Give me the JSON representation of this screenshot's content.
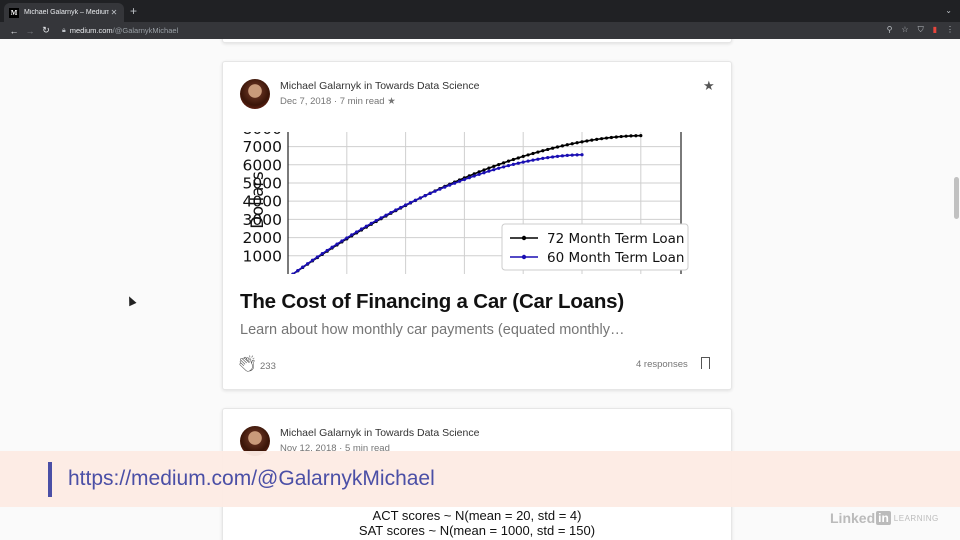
{
  "browser": {
    "tab_title": "Michael Galarnyk – Medium",
    "tab_favicon": "M",
    "url_host": "medium.com",
    "url_path": "/@GalarnykMichael",
    "icons": [
      "back-icon",
      "forward-icon",
      "reload-icon",
      "lock-icon",
      "zoom-icon",
      "bookmark-star-icon",
      "shield-icon",
      "extension-icon",
      "menu-icon"
    ]
  },
  "post": {
    "author": "Michael Galarnyk",
    "in_word": "in",
    "publication": "Towards Data Science",
    "date": "Dec 7, 2018",
    "read_time": "7 min read",
    "title": "The Cost of Financing a Car (Car Loans)",
    "subtitle": "Learn about how monthly car payments (equated monthly…",
    "claps": "233",
    "responses": "4 responses"
  },
  "post2": {
    "author": "Michael Galarnyk",
    "in_word": "in",
    "publication": "Towards Data Science",
    "date": "Nov 12, 2018",
    "read_time": "5 min read",
    "eq1": "ACT scores ~ N(mean = 20, std = 4)",
    "eq2": "SAT scores ~ N(mean = 1000, std = 150)"
  },
  "overlay_link": "https://medium.com/@GalarnykMichael",
  "watermark": {
    "brand": "Linked",
    "in": "in",
    "suffix": "LEARNING"
  },
  "colors": {
    "series72": "#000000",
    "series60": "#1a0fb3",
    "overlay_text": "#4b4fa6"
  },
  "chart_data": {
    "type": "line",
    "ylabel": "Dollars",
    "yticks": [
      1000,
      2000,
      3000,
      4000,
      5000,
      6000,
      7000
    ],
    "ylim": [
      0,
      7800
    ],
    "xlim": [
      0,
      80
    ],
    "grid": true,
    "legend_position": "lower-right",
    "series": [
      {
        "name": "72 Month Term Loan",
        "n": 72,
        "final": 7600
      },
      {
        "name": "60 Month Term Loan",
        "n": 60,
        "final": 6550
      }
    ]
  }
}
